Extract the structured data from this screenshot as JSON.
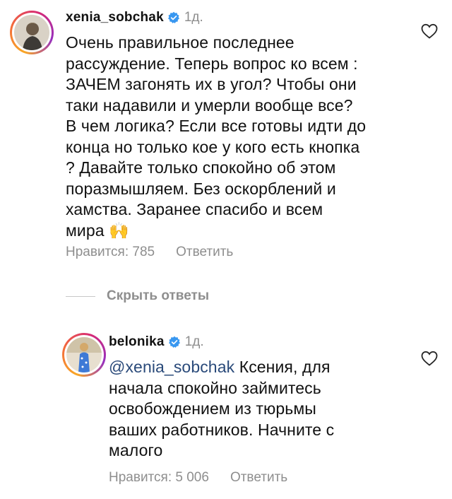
{
  "comments": [
    {
      "username": "xenia_sobchak",
      "time": "1д.",
      "text": "Очень правильное последнее\nрассуждение. Теперь вопрос ко всем :\nЗАЧЕМ загонять их в угол?  Чтобы они\nтаки надавили и умерли вообще все?\nВ чем логика? Если все готовы идти до\nконца но только кое у кого есть кнопка\n?  Давайте только спокойно об этом\nпоразмышляем. Без оскорблений и\nхамства. Заранее спасибо и всем\nмира",
      "emoji": "🙌",
      "likes": "Нравится: 785",
      "reply": "Ответить"
    },
    {
      "username": "belonika",
      "time": "1д.",
      "mention": "@xenia_sobchak",
      "text": " Ксения, для\nначала спокойно займитесь\nосвобождением из тюрьмы\nваших работников. Начните с\nмалого",
      "likes": "Нравится: 5 006",
      "reply": "Ответить"
    }
  ],
  "hide_replies": "Скрыть ответы",
  "colors": {
    "verified": "#3897f0",
    "muted": "#8e8e8e",
    "mention": "#2a4a7a"
  },
  "icons": [
    "verified-badge-icon",
    "heart-outline-icon",
    "raising-hands-emoji"
  ]
}
